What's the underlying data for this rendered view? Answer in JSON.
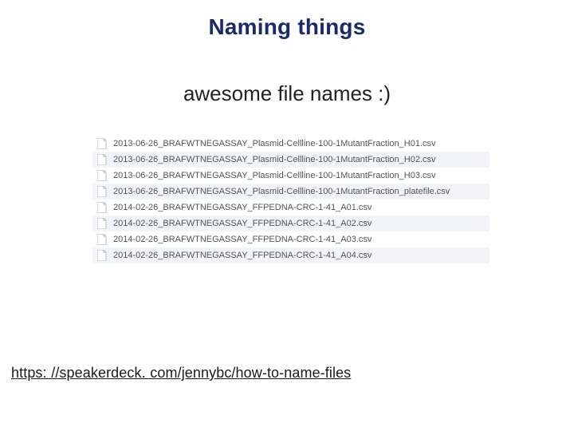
{
  "title": "Naming things",
  "subtitle": "awesome file names :)",
  "files": [
    "2013-06-26_BRAFWTNEGASSAY_Plasmid-Cellline-100-1MutantFraction_H01.csv",
    "2013-06-26_BRAFWTNEGASSAY_Plasmid-Cellline-100-1MutantFraction_H02.csv",
    "2013-06-26_BRAFWTNEGASSAY_Plasmid-Cellline-100-1MutantFraction_H03.csv",
    "2013-06-26_BRAFWTNEGASSAY_Plasmid-Cellline-100-1MutantFraction_platefile.csv",
    "2014-02-26_BRAFWTNEGASSAY_FFPEDNA-CRC-1-41_A01.csv",
    "2014-02-26_BRAFWTNEGASSAY_FFPEDNA-CRC-1-41_A02.csv",
    "2014-02-26_BRAFWTNEGASSAY_FFPEDNA-CRC-1-41_A03.csv",
    "2014-02-26_BRAFWTNEGASSAY_FFPEDNA-CRC-1-41_A04.csv"
  ],
  "citation": "https: //speakerdeck. com/jennybc/how-to-name-files"
}
